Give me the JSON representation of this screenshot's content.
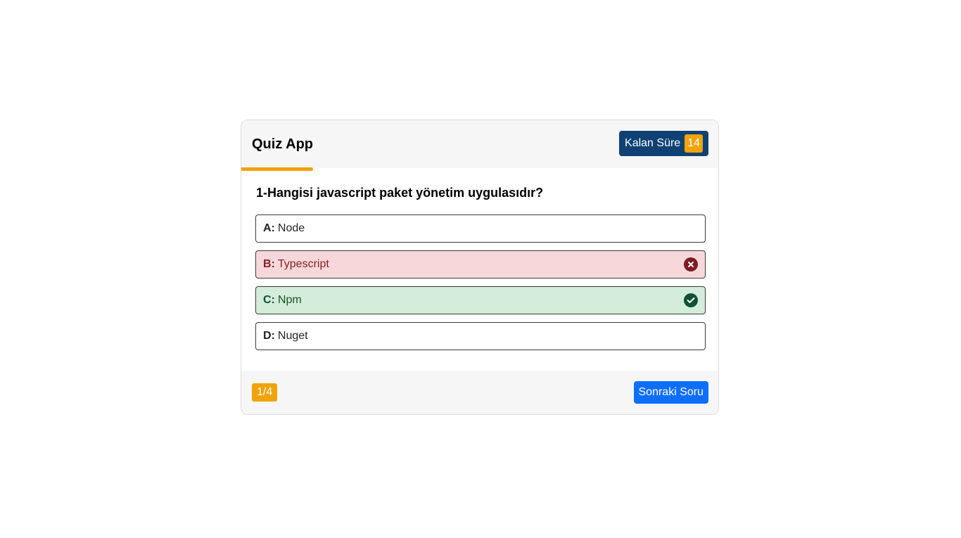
{
  "header": {
    "title": "Quiz App",
    "timer_label": "Kalan Süre",
    "timer_value": "14"
  },
  "progress": {
    "fraction": 0.15,
    "color": "#f0a30a"
  },
  "question": {
    "text": "1-Hangisi javascript paket yönetim uygulasıdır?"
  },
  "options": [
    {
      "letter": "A:",
      "text": "Node",
      "state": "neutral"
    },
    {
      "letter": "B:",
      "text": "Typescript",
      "state": "wrong",
      "icon": "x-circle-icon"
    },
    {
      "letter": "C:",
      "text": "Npm",
      "state": "correct",
      "icon": "check-circle-icon"
    },
    {
      "letter": "D:",
      "text": "Nuget",
      "state": "neutral"
    }
  ],
  "footer": {
    "page_indicator": "1/4",
    "next_label": "Sonraki Soru"
  },
  "colors": {
    "accent": "#f0a30a",
    "timer_bg": "#0f4273",
    "next_button": "#0d6efd",
    "wrong_bg": "#f8d7da",
    "correct_bg": "#d4ecda"
  }
}
